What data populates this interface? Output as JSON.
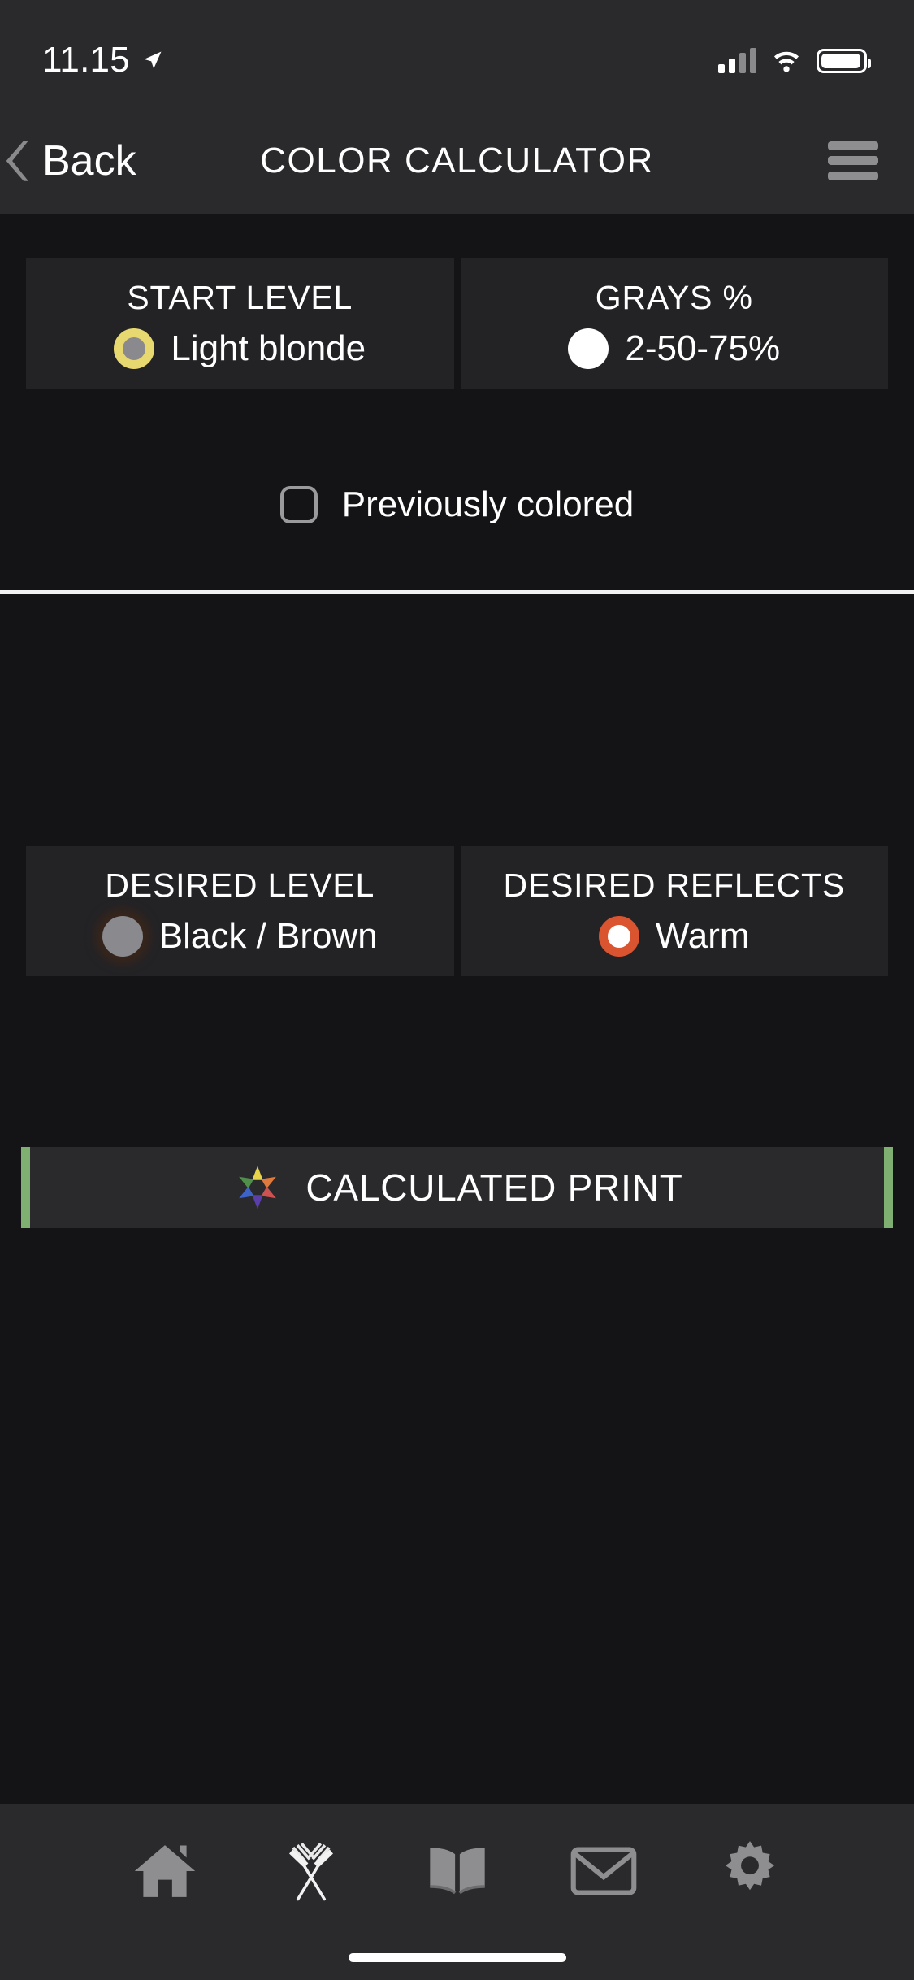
{
  "status_bar": {
    "time": "11.15",
    "location_icon": "location-arrow-icon",
    "signal_icon": "cellular-signal-icon",
    "wifi_icon": "wifi-icon",
    "battery_icon": "battery-icon"
  },
  "nav": {
    "back_label": "Back",
    "back_icon": "chevron-left-icon",
    "title": "COLOR CALCULATOR",
    "menu_icon": "hamburger-menu-icon"
  },
  "start_section": {
    "start_level": {
      "title": "START LEVEL",
      "value": "Light blonde",
      "swatch_ring_color": "#e8d870",
      "swatch_fill_color": "#8a8a8e"
    },
    "grays_percent": {
      "title": "GRAYS %",
      "value": "2-50-75%",
      "swatch_fill_color": "#ffffff"
    },
    "previously_colored": {
      "label": "Previously colored",
      "checked": false
    }
  },
  "desired_section": {
    "desired_level": {
      "title": "DESIRED LEVEL",
      "value": "Black / Brown",
      "swatch_fill_color": "#8a8a8e",
      "swatch_glow_color": "#3c2619"
    },
    "desired_reflects": {
      "title": "DESIRED REFLECTS",
      "value": "Warm",
      "swatch_ring_color": "#d9542f",
      "swatch_fill_color": "#ffffff"
    }
  },
  "calculate": {
    "label": "CALCULATED PRINT",
    "icon": "color-star-icon",
    "accent_color": "#7fb072"
  },
  "tabbar": {
    "items": [
      {
        "name": "home",
        "icon": "home-icon"
      },
      {
        "name": "brushes",
        "icon": "crossed-brushes-icon"
      },
      {
        "name": "book",
        "icon": "open-book-icon"
      },
      {
        "name": "mail",
        "icon": "envelope-icon"
      },
      {
        "name": "settings",
        "icon": "gear-icon"
      }
    ],
    "icon_color": "#8e8e90"
  }
}
